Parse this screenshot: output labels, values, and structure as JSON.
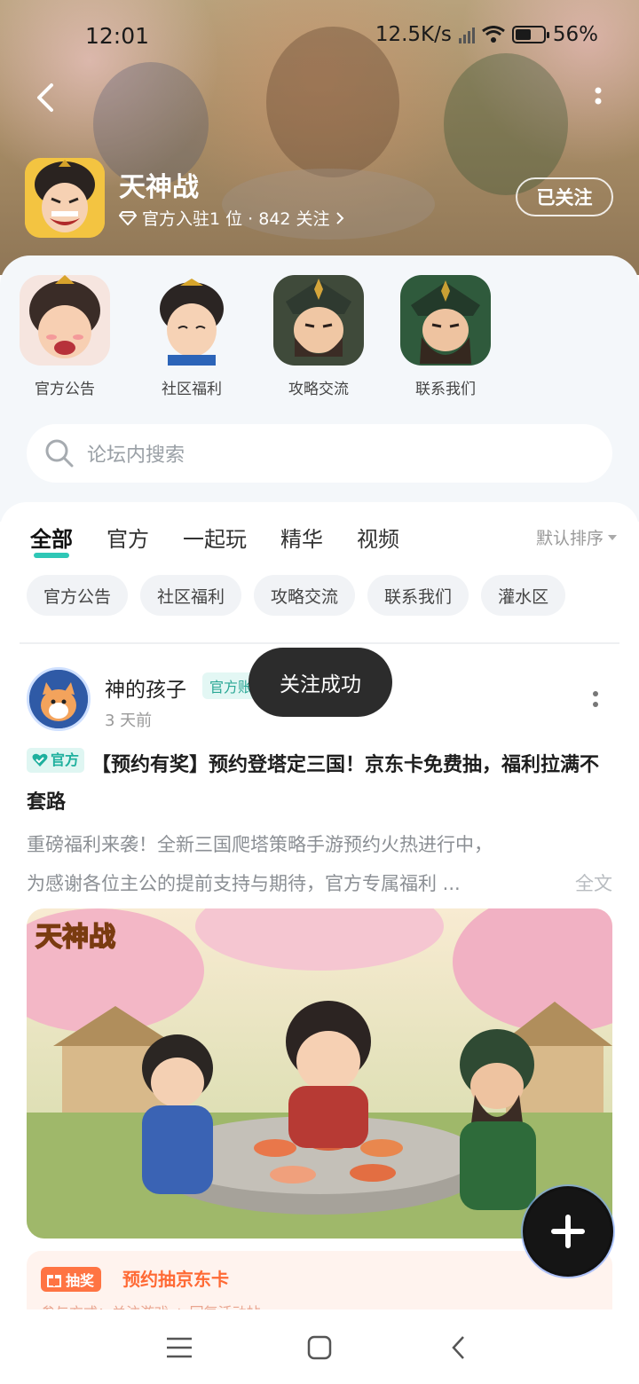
{
  "status_bar": {
    "time": "12:01",
    "network_speed": "12.5K/s",
    "battery": "56%",
    "battery_level": 0.56
  },
  "header": {
    "game_title": "天神战",
    "meta": "官方入驻1 位 · 842 关注",
    "follow_label": "已关注",
    "icons": {
      "back": "chevron-left-icon",
      "more": "more-vertical-icon",
      "diamond": "diamond-icon"
    }
  },
  "shortcuts": [
    {
      "label": "官方公告"
    },
    {
      "label": "社区福利"
    },
    {
      "label": "攻略交流"
    },
    {
      "label": "联系我们"
    }
  ],
  "search": {
    "placeholder": "论坛内搜索"
  },
  "tabs": [
    {
      "label": "全部",
      "active": true
    },
    {
      "label": "官方",
      "active": false
    },
    {
      "label": "一起玩",
      "active": false
    },
    {
      "label": "精华",
      "active": false
    },
    {
      "label": "视频",
      "active": false
    }
  ],
  "sort_label": "默认排序",
  "chips": [
    "官方公告",
    "社区福利",
    "攻略交流",
    "联系我们",
    "灌水区"
  ],
  "post": {
    "author": "神的孩子",
    "author_badge": "官方账号",
    "time": "3 天前",
    "tag": "官方",
    "title": "【预约有奖】预约登塔定三国！京东卡免费抽，福利拉满不套路",
    "excerpt_line1": "重磅福利来袭！全新三国爬塔策略手游预约火热进行中，",
    "excerpt_line2": "为感谢各位主公的提前支持与期待，官方专属福利 ...",
    "full_text_link": "全文",
    "image_logo_text": "天神战"
  },
  "lottery": {
    "tag": "抽奖",
    "title": "预约抽京东卡",
    "subtitle": "参与方式：关注游戏 + 回复活动帖"
  },
  "toast": "关注成功",
  "colors": {
    "accent": "#2fc7b6",
    "lottery": "#ff7443",
    "toast_bg": "#2c2c2c"
  }
}
